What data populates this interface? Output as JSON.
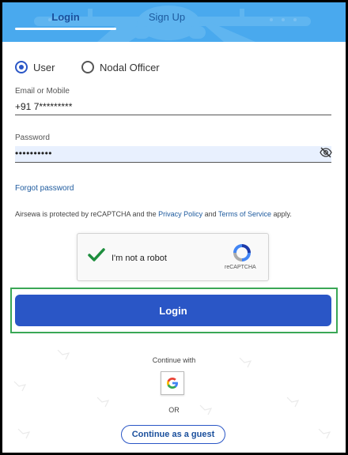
{
  "tabs": [
    {
      "label": "Login",
      "active": true
    },
    {
      "label": "Sign Up",
      "active": false
    }
  ],
  "user_type": {
    "options": [
      {
        "label": "User",
        "selected": true
      },
      {
        "label": "Nodal Officer",
        "selected": false
      }
    ]
  },
  "email": {
    "label": "Email or Mobile",
    "value": "+91 7*********"
  },
  "password": {
    "label": "Password",
    "value": "••••••••••"
  },
  "forgot_password": "Forgot password",
  "captcha_note": {
    "prefix": "Airsewa is protected by reCAPTCHA and the ",
    "privacy": "Privacy Policy",
    "and": " and ",
    "terms": "Terms of Service",
    "suffix": " apply."
  },
  "recaptcha": {
    "label": "I'm not a robot",
    "brand": "reCAPTCHA",
    "checked": true
  },
  "login_button": "Login",
  "continue_with": "Continue with",
  "or_text": "OR",
  "guest_button": "Continue as a guest",
  "colors": {
    "header": "#49a9ee",
    "primary": "#2a56c6",
    "highlight": "#3aa756"
  }
}
